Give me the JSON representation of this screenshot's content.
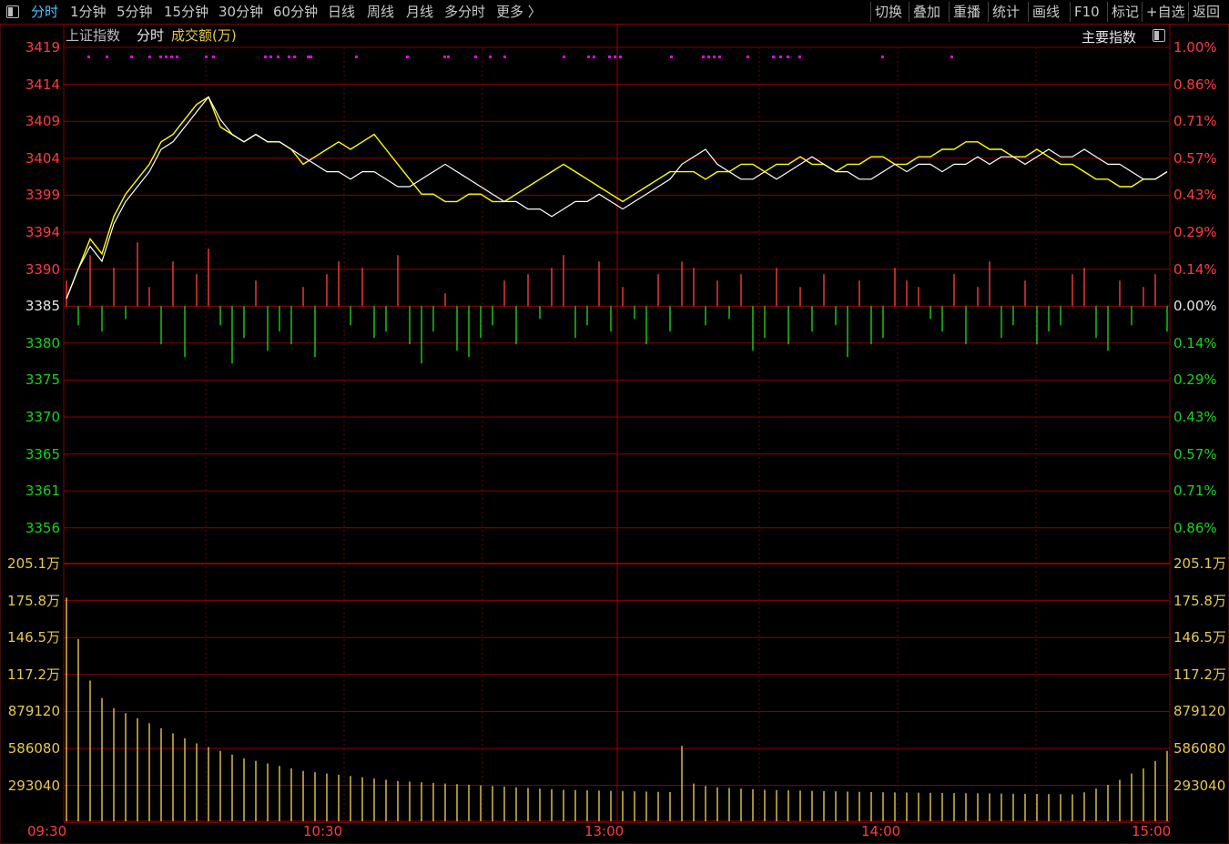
{
  "toolbar": {
    "left_tabs": [
      "分时",
      "1分钟",
      "5分钟",
      "15分钟",
      "30分钟",
      "60分钟",
      "日线",
      "周线",
      "月线",
      "多分时",
      "更多 〉"
    ],
    "right_tabs": [
      "切换",
      "叠加",
      "重播",
      "统计",
      "画线",
      "F10",
      "标记",
      "+自选",
      "返回"
    ]
  },
  "subheader": {
    "index_name": "上证指数",
    "mode": "分时",
    "volume_label": "成交额(万)",
    "main_index": "主要指数"
  },
  "colors": {
    "price_line": "#ffffff",
    "avg_line": "#ffff00",
    "up": "#ff3b3b",
    "down": "#19d219",
    "volume": "#e6c84c",
    "grid": "#8b0000",
    "marker": "#ff00ff"
  },
  "axes": {
    "price_left": [
      {
        "text": "3419",
        "cls": "red"
      },
      {
        "text": "3414",
        "cls": "red"
      },
      {
        "text": "3409",
        "cls": "red"
      },
      {
        "text": "3404",
        "cls": "red"
      },
      {
        "text": "3399",
        "cls": "red"
      },
      {
        "text": "3394",
        "cls": "red"
      },
      {
        "text": "3390",
        "cls": "red"
      },
      {
        "text": "3385",
        "cls": "white"
      },
      {
        "text": "3380",
        "cls": "green"
      },
      {
        "text": "3375",
        "cls": "green"
      },
      {
        "text": "3370",
        "cls": "green"
      },
      {
        "text": "3365",
        "cls": "green"
      },
      {
        "text": "3361",
        "cls": "green"
      },
      {
        "text": "3356",
        "cls": "green"
      }
    ],
    "pct_right": [
      {
        "text": "1.00%",
        "cls": "red"
      },
      {
        "text": "0.86%",
        "cls": "red"
      },
      {
        "text": "0.71%",
        "cls": "red"
      },
      {
        "text": "0.57%",
        "cls": "red"
      },
      {
        "text": "0.43%",
        "cls": "red"
      },
      {
        "text": "0.29%",
        "cls": "red"
      },
      {
        "text": "0.14%",
        "cls": "red"
      },
      {
        "text": "0.00%",
        "cls": "white"
      },
      {
        "text": "0.14%",
        "cls": "green"
      },
      {
        "text": "0.29%",
        "cls": "green"
      },
      {
        "text": "0.43%",
        "cls": "green"
      },
      {
        "text": "0.57%",
        "cls": "green"
      },
      {
        "text": "0.71%",
        "cls": "green"
      },
      {
        "text": "0.86%",
        "cls": "green"
      }
    ],
    "volume": [
      "205.1万",
      "175.8万",
      "146.5万",
      "117.2万",
      "879120",
      "586080",
      "293040"
    ],
    "time": [
      "09:30",
      "10:30",
      "13:00",
      "14:00",
      "15:00"
    ]
  },
  "chart_data": {
    "type": "line",
    "title": "上证指数 分时",
    "prev_close": 3385,
    "ylim": [
      3352,
      3419
    ],
    "volume_ylim": [
      0,
      2051000
    ],
    "price": [
      3386,
      3390,
      3393,
      3391,
      3396,
      3399,
      3401,
      3403,
      3406,
      3407,
      3409,
      3411,
      3413,
      3410,
      3408,
      3407,
      3408,
      3407,
      3407,
      3406,
      3405,
      3404,
      3403,
      3403,
      3402,
      3403,
      3403,
      3402,
      3401,
      3401,
      3402,
      3403,
      3404,
      3403,
      3402,
      3401,
      3400,
      3399,
      3399,
      3398,
      3398,
      3397,
      3398,
      3399,
      3399,
      3400,
      3399,
      3398,
      3399,
      3400,
      3401,
      3402,
      3404,
      3405,
      3406,
      3404,
      3403,
      3402,
      3402,
      3403,
      3402,
      3403,
      3404,
      3405,
      3404,
      3403,
      3403,
      3402,
      3402,
      3403,
      3404,
      3403,
      3404,
      3404,
      3403,
      3404,
      3404,
      3405,
      3404,
      3405,
      3405,
      3404,
      3405,
      3406,
      3405,
      3405,
      3406,
      3405,
      3404,
      3404,
      3403,
      3402,
      3402,
      3403
    ],
    "avg": [
      3386,
      3390,
      3394,
      3392,
      3397,
      3400,
      3402,
      3404,
      3407,
      3408,
      3410,
      3412,
      3413,
      3409,
      3408,
      3407,
      3408,
      3407,
      3407,
      3406,
      3404,
      3405,
      3406,
      3407,
      3406,
      3407,
      3408,
      3406,
      3404,
      3402,
      3400,
      3400,
      3399,
      3399,
      3400,
      3400,
      3399,
      3399,
      3400,
      3401,
      3402,
      3403,
      3404,
      3403,
      3402,
      3401,
      3400,
      3399,
      3400,
      3401,
      3402,
      3403,
      3403,
      3403,
      3402,
      3403,
      3403,
      3404,
      3404,
      3403,
      3404,
      3404,
      3405,
      3404,
      3404,
      3403,
      3404,
      3404,
      3405,
      3405,
      3404,
      3404,
      3405,
      3405,
      3406,
      3406,
      3407,
      3407,
      3406,
      3406,
      3405,
      3405,
      3406,
      3405,
      3404,
      3404,
      3403,
      3402,
      3402,
      3401,
      3401,
      3402,
      3402,
      3403
    ],
    "breadth": [
      4,
      -3,
      8,
      -4,
      6,
      -2,
      10,
      3,
      -6,
      7,
      -8,
      5,
      9,
      -3,
      -9,
      -5,
      4,
      -7,
      -4,
      -6,
      3,
      -8,
      5,
      7,
      -3,
      6,
      -5,
      -4,
      8,
      -6,
      -9,
      -4,
      2,
      -7,
      -8,
      -5,
      -3,
      4,
      -6,
      5,
      -2,
      6,
      8,
      -5,
      -3,
      7,
      -4,
      3,
      -2,
      -6,
      5,
      -4,
      7,
      6,
      -3,
      4,
      -2,
      5,
      -7,
      -5,
      6,
      -6,
      3,
      -4,
      5,
      -3,
      -8,
      4,
      -6,
      -5,
      6,
      4,
      3,
      -2,
      -4,
      5,
      -6,
      3,
      7,
      -5,
      -3,
      4,
      -6,
      -4,
      -3,
      5,
      6,
      -5,
      -7,
      4,
      -3,
      3,
      5,
      -4
    ],
    "volume": [
      1780000,
      1450000,
      1120000,
      980000,
      900000,
      860000,
      820000,
      780000,
      740000,
      700000,
      660000,
      620000,
      590000,
      560000,
      530000,
      500000,
      480000,
      460000,
      440000,
      420000,
      400000,
      390000,
      380000,
      370000,
      360000,
      350000,
      340000,
      330000,
      320000,
      315000,
      310000,
      305000,
      300000,
      295000,
      290000,
      285000,
      280000,
      275000,
      270000,
      265000,
      260000,
      255000,
      250000,
      248000,
      246000,
      244000,
      242000,
      240000,
      238000,
      236000,
      234000,
      232000,
      600000,
      300000,
      280000,
      270000,
      265000,
      260000,
      255000,
      250000,
      248000,
      246000,
      244000,
      242000,
      240000,
      238000,
      236000,
      234000,
      232000,
      230000,
      229000,
      228000,
      227000,
      226000,
      225000,
      224000,
      223000,
      222000,
      221000,
      220000,
      219000,
      218000,
      217000,
      216000,
      215000,
      214000,
      230000,
      260000,
      290000,
      330000,
      380000,
      420000,
      480000,
      560000
    ]
  }
}
